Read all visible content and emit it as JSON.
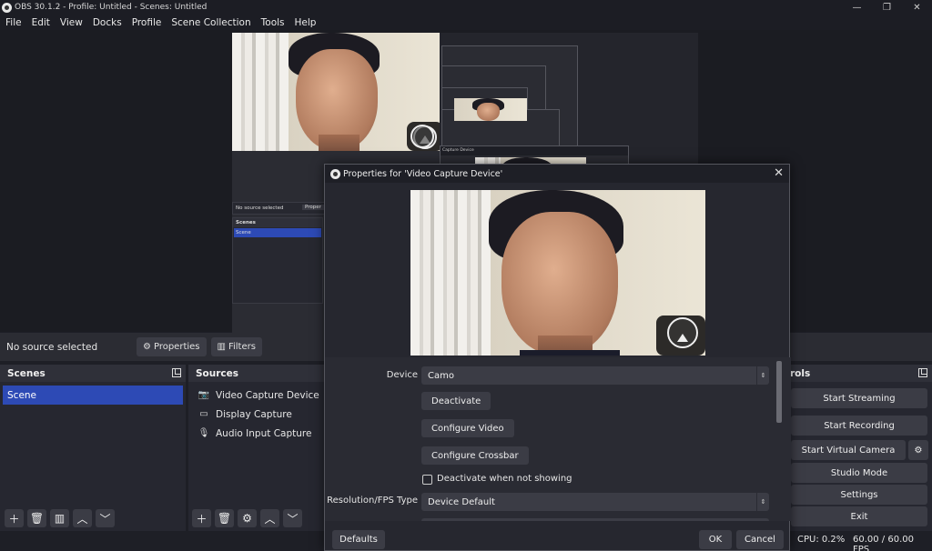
{
  "window": {
    "title": "OBS 30.1.2 - Profile: Untitled - Scenes: Untitled",
    "minimize": "—",
    "maximize": "❐",
    "close": "✕"
  },
  "menu": [
    "File",
    "Edit",
    "View",
    "Docks",
    "Profile",
    "Scene Collection",
    "Tools",
    "Help"
  ],
  "nested_preview": {
    "capture_title": "Capture Device",
    "no_source": "No source selected",
    "properties": "Proper",
    "scenes_header": "Scenes",
    "scene_item": "Scene"
  },
  "source_bar": {
    "status": "No source selected",
    "properties_label": "Properties",
    "filters_label": "Filters"
  },
  "scenes": {
    "header": "Scenes",
    "items": [
      "Scene"
    ]
  },
  "sources": {
    "header": "Sources",
    "items": [
      {
        "label": "Video Capture Device",
        "icon": "camera-icon"
      },
      {
        "label": "Display Capture",
        "icon": "monitor-icon"
      },
      {
        "label": "Audio Input Capture",
        "icon": "microphone-icon"
      }
    ]
  },
  "controls": {
    "header_partial": "rols",
    "start_streaming": "Start Streaming",
    "start_recording": "Start Recording",
    "start_virtual_camera": "Start Virtual Camera",
    "studio_mode": "Studio Mode",
    "settings": "Settings",
    "exit": "Exit"
  },
  "status": {
    "cpu": "CPU: 0.2%",
    "fps": "60.00 / 60.00 FPS"
  },
  "dialog": {
    "title": "Properties for 'Video Capture Device'",
    "close": "✕",
    "device_label": "Device",
    "device_value": "Camo",
    "deactivate": "Deactivate",
    "configure_video": "Configure Video",
    "configure_crossbar": "Configure Crossbar",
    "deactivate_when_not_showing": "Deactivate when not showing",
    "deactivate_when_not_showing_checked": false,
    "resolution_label": "Resolution/FPS Type",
    "resolution_value": "Device Default",
    "defaults": "Defaults",
    "ok": "OK",
    "cancel": "Cancel"
  },
  "colors": {
    "accent": "#2d4ab5",
    "panel": "#262730",
    "button": "#3b3c45",
    "background": "#1e1f26"
  }
}
